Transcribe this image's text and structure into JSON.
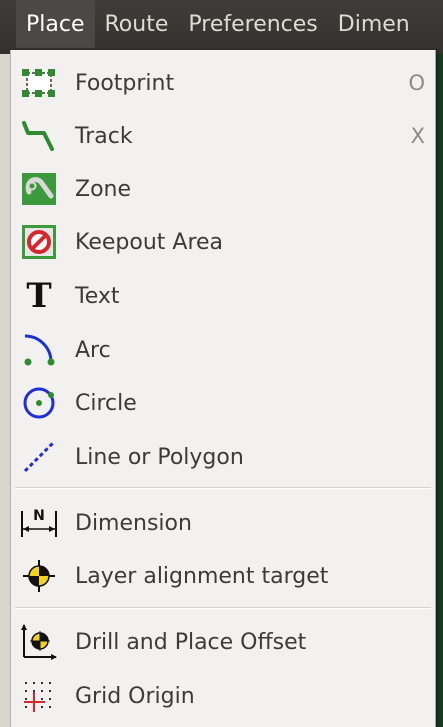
{
  "menubar": {
    "items": [
      {
        "label": "Place"
      },
      {
        "label": "Route"
      },
      {
        "label": "Preferences"
      },
      {
        "label": "Dimen"
      }
    ]
  },
  "place_menu": {
    "items": [
      {
        "label": "Footprint",
        "shortcut": "O",
        "icon": "footprint-icon"
      },
      {
        "label": "Track",
        "shortcut": "X",
        "icon": "track-icon"
      },
      {
        "label": "Zone",
        "icon": "zone-icon"
      },
      {
        "label": "Keepout Area",
        "icon": "keepout-icon"
      },
      {
        "label": "Text",
        "icon": "text-icon"
      },
      {
        "label": "Arc",
        "icon": "arc-icon"
      },
      {
        "label": "Circle",
        "icon": "circle-icon"
      },
      {
        "label": "Line or Polygon",
        "icon": "line-polygon-icon"
      },
      {
        "label": "Dimension",
        "icon": "dimension-icon"
      },
      {
        "label": "Layer alignment target",
        "icon": "alignment-target-icon"
      },
      {
        "label": "Drill and Place Offset",
        "icon": "drill-offset-icon"
      },
      {
        "label": "Grid Origin",
        "icon": "grid-origin-icon"
      }
    ]
  },
  "icons": {
    "dimension_letter": "N",
    "text_glyph": "T"
  },
  "colors": {
    "menubar_bg": "#3a3935",
    "menu_bg": "#f2f1f0",
    "icon_green": "#2e8b2e",
    "icon_blue": "#1f2fd6",
    "keepout_red": "#d9262c",
    "target_yellow": "#f2d21a"
  }
}
